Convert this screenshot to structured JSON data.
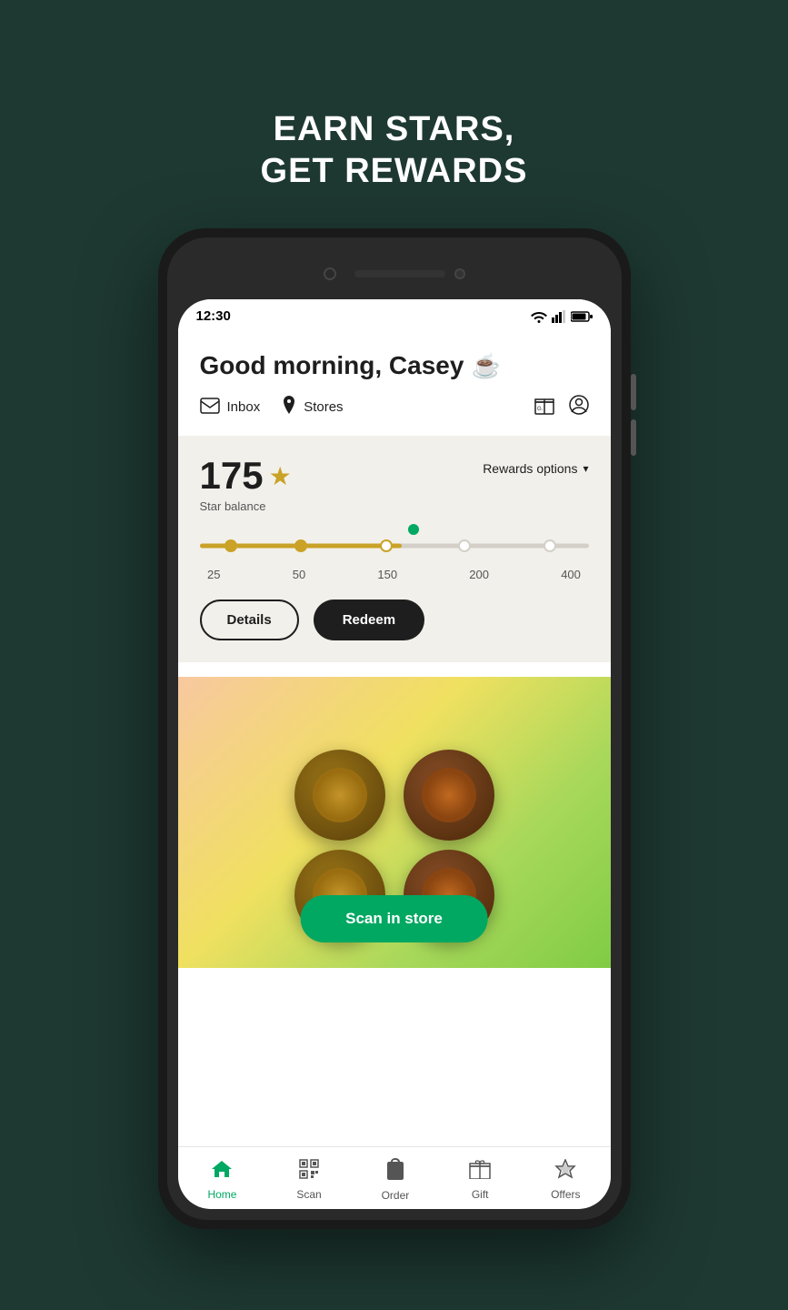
{
  "page": {
    "background_color": "#1e3932",
    "hero_title_line1": "EARN STARS,",
    "hero_title_line2": "GET REWARDS"
  },
  "phone": {
    "status_bar": {
      "time": "12:30"
    }
  },
  "app": {
    "greeting": "Good morning, Casey",
    "greeting_emoji": "☕",
    "nav_links": {
      "inbox": "Inbox",
      "stores": "Stores"
    },
    "stars": {
      "count": "175",
      "label": "Star balance",
      "rewards_options_label": "Rewards options"
    },
    "progress": {
      "markers": [
        "25",
        "50",
        "150",
        "200",
        "400"
      ]
    },
    "buttons": {
      "details": "Details",
      "redeem": "Redeem",
      "scan_in_store": "Scan in store"
    },
    "bottom_nav": [
      {
        "icon": "🏠",
        "label": "Home",
        "active": true
      },
      {
        "icon": "⬛",
        "label": "Scan",
        "active": false
      },
      {
        "icon": "🥤",
        "label": "Order",
        "active": false
      },
      {
        "icon": "🎁",
        "label": "Gift",
        "active": false
      },
      {
        "icon": "⭐",
        "label": "Offers",
        "active": false
      }
    ]
  }
}
